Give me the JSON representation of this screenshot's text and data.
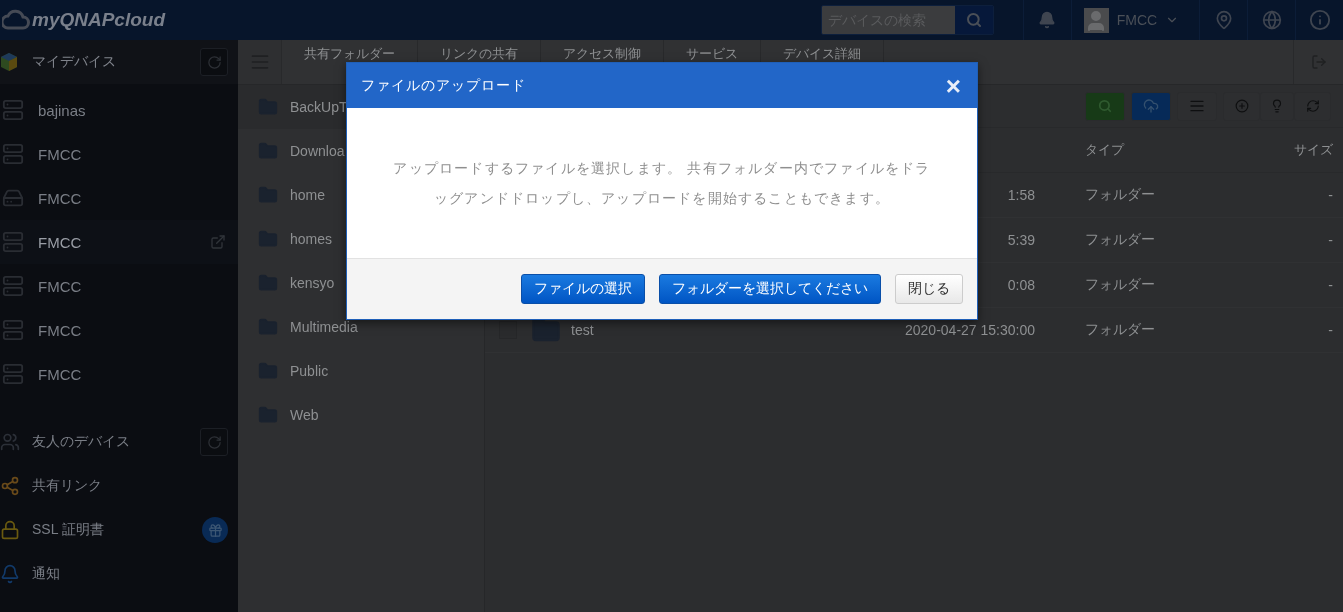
{
  "header": {
    "logo": "myQNAPcloud",
    "search": {
      "placeholder": "デバイスの検索"
    },
    "user": "FMCC"
  },
  "sidebar": {
    "my_devices": {
      "title": "マイデバイス",
      "items": [
        {
          "name": "bajinas",
          "kind": "tower",
          "selected": false
        },
        {
          "name": "FMCC",
          "kind": "tower",
          "selected": false
        },
        {
          "name": "FMCC",
          "kind": "rack",
          "selected": false
        },
        {
          "name": "FMCC",
          "kind": "tower",
          "selected": true
        },
        {
          "name": "FMCC",
          "kind": "tower",
          "selected": false
        },
        {
          "name": "FMCC",
          "kind": "tower",
          "selected": false
        },
        {
          "name": "FMCC",
          "kind": "tower",
          "selected": false
        }
      ]
    },
    "sections": [
      {
        "label": "友人のデバイス",
        "kind": "friends"
      },
      {
        "label": "共有リンク",
        "kind": "share"
      },
      {
        "label": "SSL 証明書",
        "kind": "ssl"
      },
      {
        "label": "通知",
        "kind": "notify"
      }
    ]
  },
  "tabs": [
    "共有フォルダー",
    "リンクの共有",
    "アクセス制御",
    "サービス",
    "デバイス詳細"
  ],
  "folders": [
    "BackUpT",
    "Downloa",
    "home",
    "homes",
    "kensyo",
    "Multimedia",
    "Public",
    "Web"
  ],
  "table": {
    "columns": [
      "タイプ",
      "サイズ"
    ],
    "rows": [
      {
        "date": "1:58",
        "type": "フォルダー",
        "size": "-"
      },
      {
        "date": "5:39",
        "type": "フォルダー",
        "size": "-"
      },
      {
        "date": "0:08",
        "type": "フォルダー",
        "size": "-"
      },
      {
        "name": "test",
        "checked": false,
        "date": "2020-04-27 15:30:00",
        "type": "フォルダー",
        "size": "-"
      }
    ]
  },
  "dialog": {
    "title": "ファイルのアップロード",
    "message": "アップロードするファイルを選択します。 共有フォルダー内でファイルをドラッグアンドドロップし、アップロードを開始することもできます。",
    "close": "×",
    "buttons": [
      {
        "label": "ファイルの選択",
        "kind": "primary"
      },
      {
        "label": "フォルダーを選択してください",
        "kind": "primary"
      },
      {
        "label": "閉じる",
        "kind": "default"
      }
    ]
  }
}
